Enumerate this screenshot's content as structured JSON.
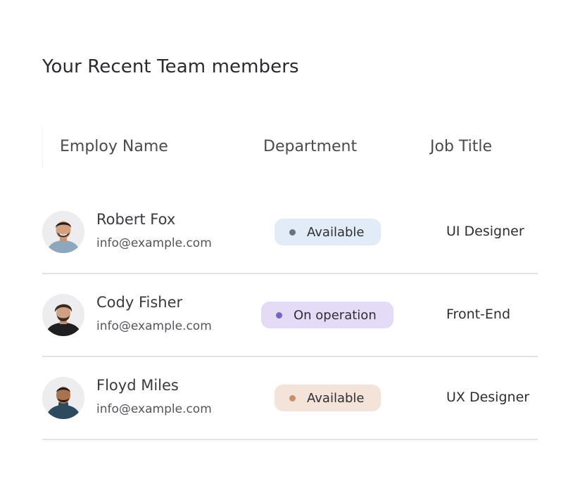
{
  "title": "Your Recent Team members",
  "columns": {
    "name": "Employ Name",
    "department": "Department",
    "job": "Job Title"
  },
  "members": [
    {
      "name": "Robert Fox",
      "email": "info@example.com",
      "status": "Available",
      "status_bg": "#e2ecf8",
      "status_dot": "#6b7380",
      "job": "UI Designer",
      "avatar_icon": "man-portrait-icon"
    },
    {
      "name": "Cody Fisher",
      "email": "info@example.com",
      "status": "On operation",
      "status_bg": "#e4dcf6",
      "status_dot": "#7a62c9",
      "job": "Front-End",
      "avatar_icon": "man-portrait-icon"
    },
    {
      "name": "Floyd Miles",
      "email": "info@example.com",
      "status": "Available",
      "status_bg": "#f4e3d8",
      "status_dot": "#cc8d6e",
      "job": "UX Designer",
      "avatar_icon": "man-portrait-icon"
    }
  ]
}
